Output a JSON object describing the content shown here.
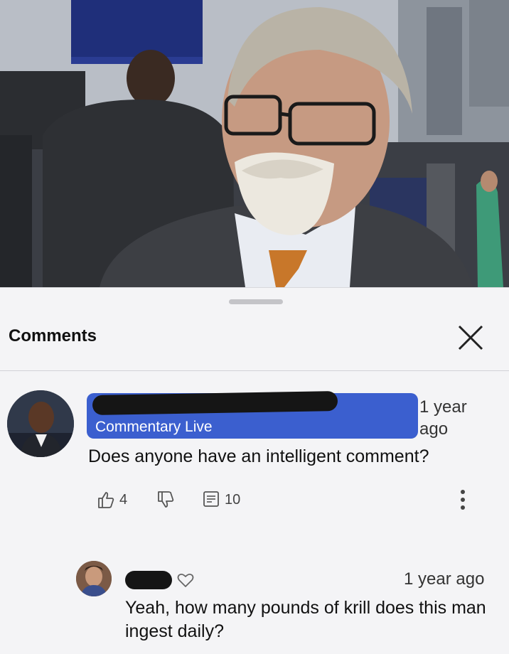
{
  "sheet": {
    "title": "Comments",
    "close_icon": "close-icon"
  },
  "comments": [
    {
      "author_sub": "Commentary Live",
      "timestamp": "1 year ago",
      "text": "Does anyone have an intelligent comment?",
      "likes": "4",
      "replies": "10",
      "icons": [
        "like-icon",
        "dislike-icon",
        "reply-icon",
        "more-icon"
      ]
    },
    {
      "timestamp": "1 year ago",
      "text": "Yeah, how many pounds of krill does this man ingest daily?",
      "icons": [
        "heart-icon"
      ]
    }
  ],
  "colors": {
    "author_bar": "#3b5fcf",
    "sheet_bg": "#f4f4f6",
    "redaction": "#151515"
  }
}
